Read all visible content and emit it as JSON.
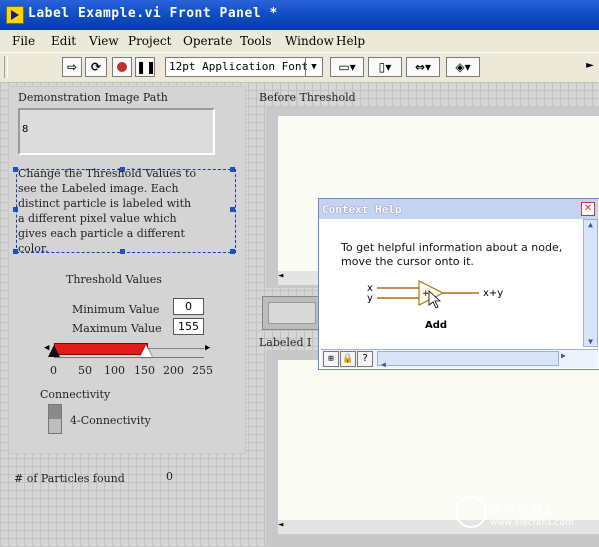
{
  "window": {
    "title": "Label Example.vi Front Panel *"
  },
  "menu": [
    "File",
    "Edit",
    "View",
    "Project",
    "Operate",
    "Tools",
    "Window",
    "Help"
  ],
  "toolbar": {
    "font": "12pt Application Font"
  },
  "left": {
    "path_label": "Demonstration Image Path",
    "path_value": "8",
    "description": [
      "Change the Threshold Values to",
      "see the Labeled image.  Each",
      "distinct particle is labeled with",
      "a different pixel value which",
      "gives each particle a different",
      "color."
    ],
    "threshold_title": "Threshold Values",
    "min_label": "Minimum Value",
    "min_value": "0",
    "max_label": "Maximum Value",
    "max_value": "155",
    "scale": [
      "0",
      "50",
      "100",
      "150",
      "200",
      "255"
    ],
    "connectivity_label": "Connectivity",
    "connectivity_value": "4-Connectivity",
    "particles_label": "# of Particles found",
    "particles_value": "0"
  },
  "right": {
    "before_label": "Before Threshold",
    "labeled_label": "Labeled I"
  },
  "context_help": {
    "title": "Context Help",
    "line1": "To get helpful information about a node,",
    "line2": "move the cursor onto it.",
    "in_x": "x",
    "in_y": "y",
    "out": "x+y",
    "node": "Add"
  },
  "watermark": {
    "text": "电子发烧友",
    "url": "www.elecfans.com"
  }
}
